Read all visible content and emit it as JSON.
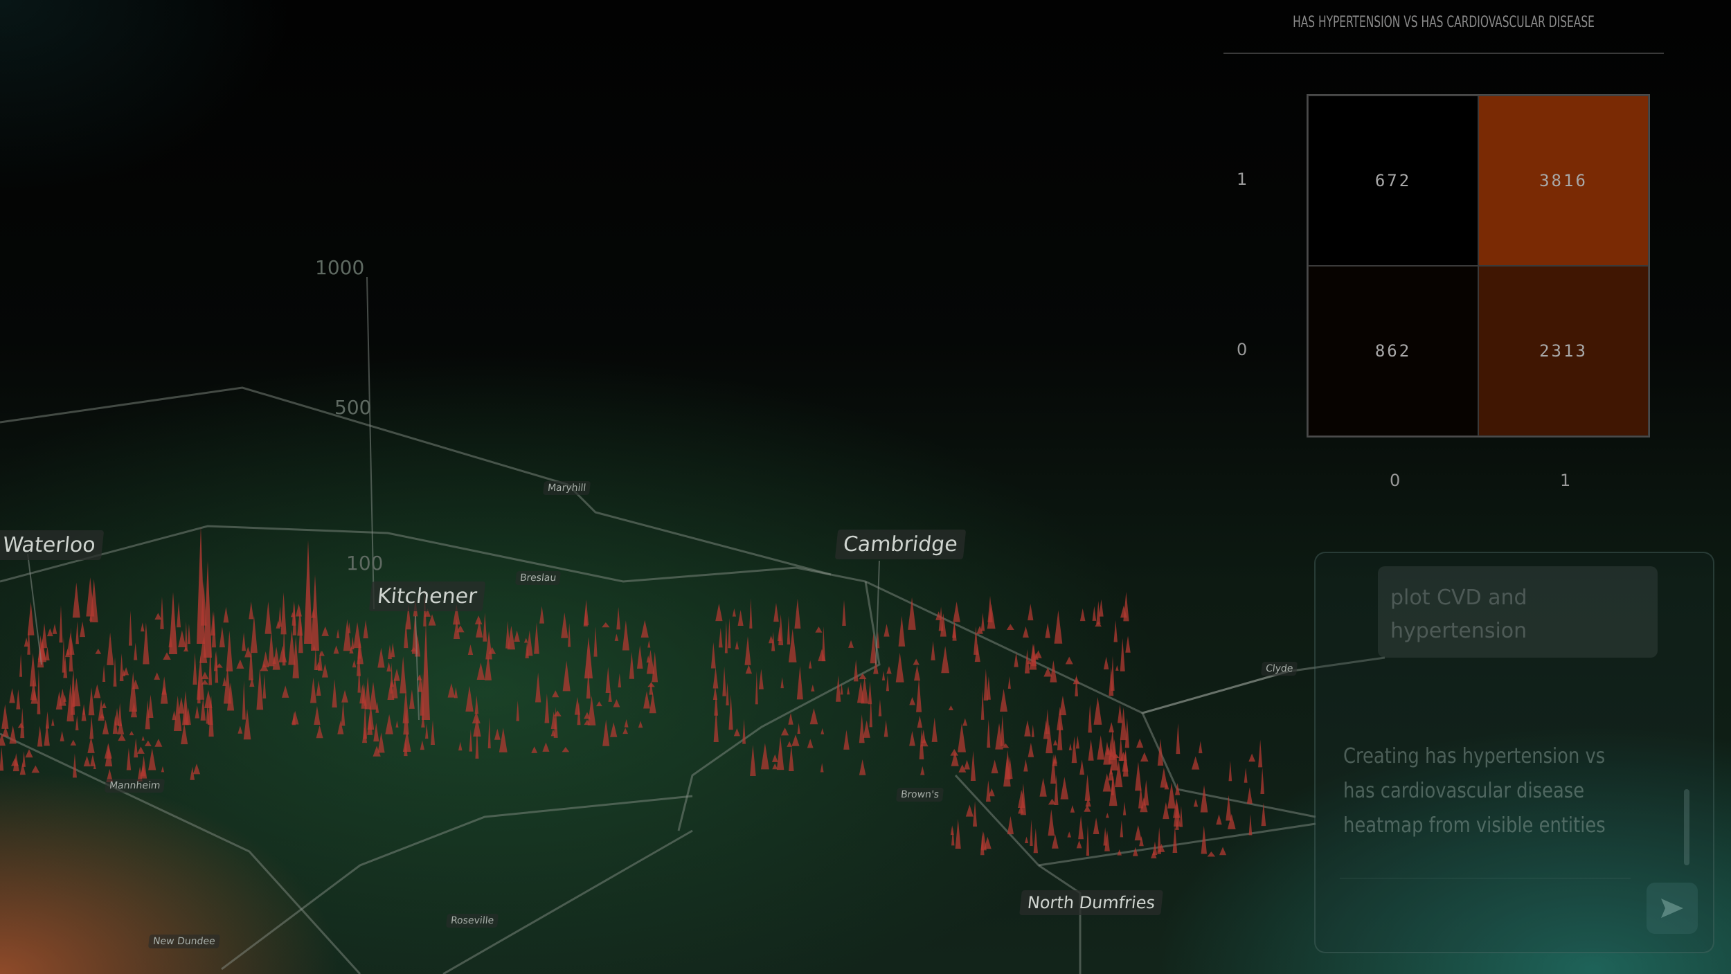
{
  "map": {
    "labels": {
      "waterloo": "Waterloo",
      "kitchener": "Kitchener",
      "cambridge": "Cambridge",
      "north_dumfries": "North Dumfries",
      "browns": "Brown's",
      "clyde": "Clyde",
      "roseville": "Roseville",
      "new_dundee": "New Dundee",
      "mannheim": "Mannheim",
      "breslau": "Breslau",
      "maryhill": "Maryhill"
    },
    "scale": {
      "s1000": "1000",
      "s500": "500",
      "s100": "100"
    },
    "colors": {
      "spike": "#b33a32",
      "road": "#9aa39c"
    }
  },
  "chart_data": {
    "type": "heatmap",
    "title": "HAS HYPERTENSION VS HAS CARDIOVASCULAR DISEASE",
    "x_categories": [
      "0",
      "1"
    ],
    "y_categories": [
      "1",
      "0"
    ],
    "matrix": [
      [
        672,
        3816
      ],
      [
        862,
        2313
      ]
    ],
    "colors": {
      "high": "#7a2a04",
      "mid": "#1c0a05",
      "low": "#000000"
    }
  },
  "chat": {
    "user_message": "plot CVD and hypertension",
    "status": "Creating has hypertension vs has cardiovascular disease heatmap from visible entities",
    "send_icon": "send-icon"
  }
}
